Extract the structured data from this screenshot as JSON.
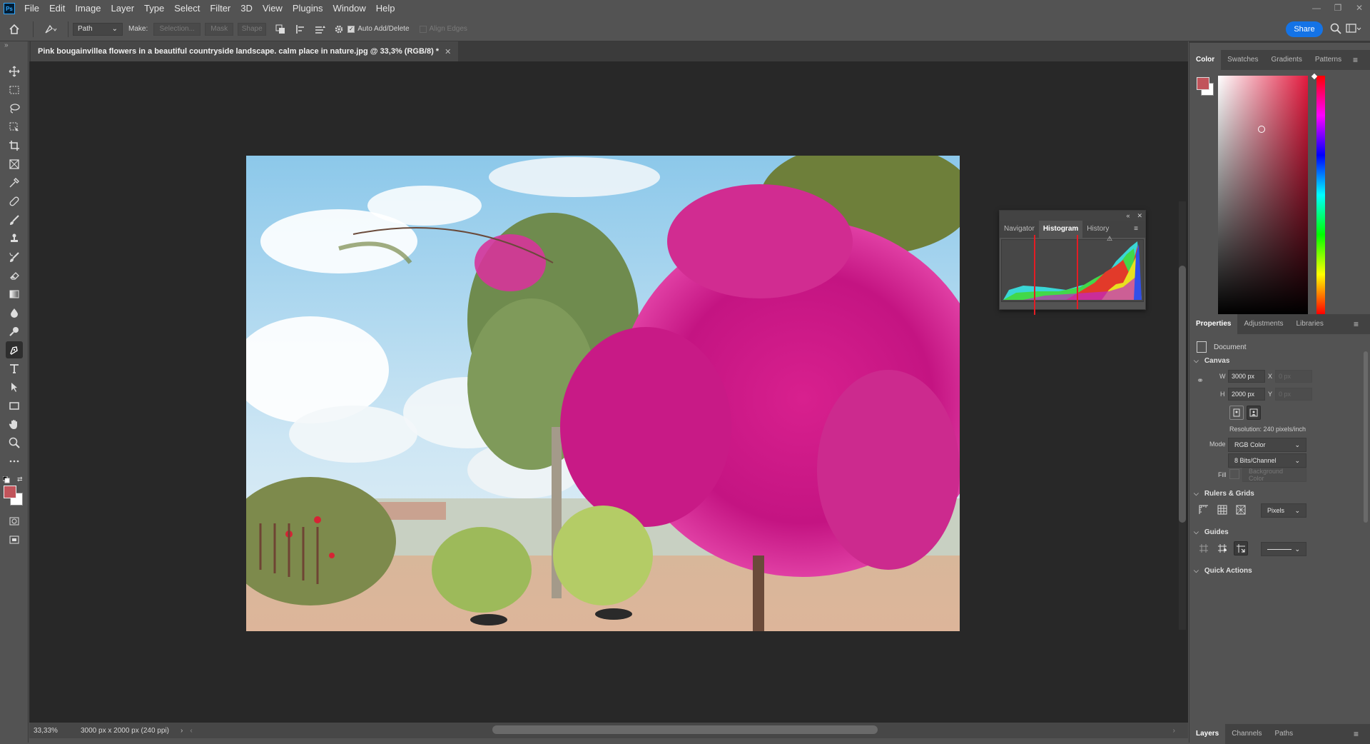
{
  "menubar": {
    "logo": "Ps",
    "items": [
      "File",
      "Edit",
      "Image",
      "Layer",
      "Type",
      "Select",
      "Filter",
      "3D",
      "View",
      "Plugins",
      "Window",
      "Help"
    ]
  },
  "options": {
    "mode_value": "Path",
    "make_label": "Make:",
    "selection_label": "Selection...",
    "mask_label": "Mask",
    "shape_label": "Shape",
    "auto_add_delete": "Auto Add/Delete",
    "align_edges": "Align Edges",
    "share": "Share"
  },
  "document": {
    "tab_title": "Pink bougainvillea flowers in a beautiful countryside landscape. calm place in nature.jpg @ 33,3% (RGB/8) *",
    "zoom": "33,33%",
    "doc_info": "3000 px x 2000 px (240 ppi)"
  },
  "histogram_panel": {
    "tabs": [
      "Navigator",
      "Histogram",
      "History"
    ],
    "selected": "Histogram"
  },
  "color_panel": {
    "tabs": [
      "Color",
      "Swatches",
      "Gradients",
      "Patterns"
    ],
    "foreground": "#c1545b",
    "background": "#ffffff"
  },
  "properties": {
    "tabs": [
      "Properties",
      "Adjustments",
      "Libraries"
    ],
    "doc_label": "Document",
    "canvas": {
      "title": "Canvas",
      "w_label": "W",
      "w_value": "3000 px",
      "h_label": "H",
      "h_value": "2000 px",
      "x_label": "X",
      "x_value": "0 px",
      "y_label": "Y",
      "y_value": "0 px",
      "resolution": "Resolution: 240 pixels/inch",
      "mode_label": "Mode",
      "mode_value": "RGB Color",
      "bits_value": "8 Bits/Channel",
      "fill_label": "Fill",
      "fill_value": "Background Color"
    },
    "rulers": {
      "title": "Rulers & Grids",
      "units": "Pixels"
    },
    "guides": {
      "title": "Guides"
    },
    "quick_actions": {
      "title": "Quick Actions"
    }
  },
  "layers_panel": {
    "tabs": [
      "Layers",
      "Channels",
      "Paths"
    ]
  }
}
